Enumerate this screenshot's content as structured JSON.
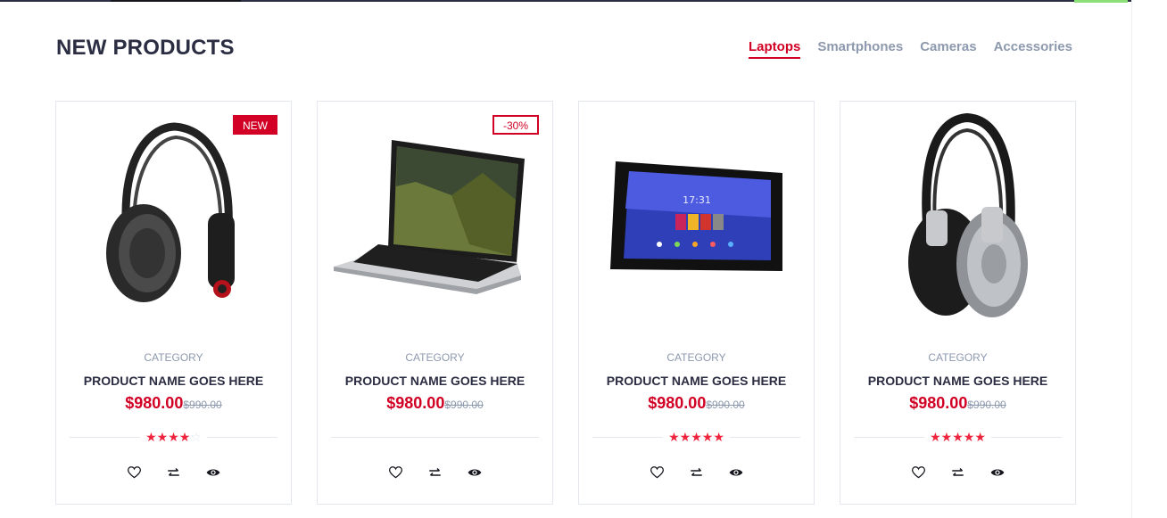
{
  "section": {
    "title": "NEW PRODUCTS"
  },
  "tabs": [
    {
      "label": "Laptops",
      "active": true
    },
    {
      "label": "Smartphones",
      "active": false
    },
    {
      "label": "Cameras",
      "active": false
    },
    {
      "label": "Accessories",
      "active": false
    }
  ],
  "products": [
    {
      "badge": "NEW",
      "badge_type": "new",
      "image": "headphones-black-icon",
      "category": "CATEGORY",
      "name": "PRODUCT NAME GOES HERE",
      "price": "$980.00",
      "old_price": "$990.00",
      "rating": 4
    },
    {
      "badge": "-30%",
      "badge_type": "sale",
      "image": "laptop-icon",
      "category": "CATEGORY",
      "name": "PRODUCT NAME GOES HERE",
      "price": "$980.00",
      "old_price": "$990.00",
      "rating": 0
    },
    {
      "badge": "",
      "badge_type": "",
      "image": "tablet-icon",
      "category": "CATEGORY",
      "name": "PRODUCT NAME GOES HERE",
      "price": "$980.00",
      "old_price": "$990.00",
      "rating": 5
    },
    {
      "badge": "",
      "badge_type": "",
      "image": "headphones-silver-icon",
      "category": "CATEGORY",
      "name": "PRODUCT NAME GOES HERE",
      "price": "$980.00",
      "old_price": "$990.00",
      "rating": 5
    }
  ],
  "colors": {
    "accent": "#d10024",
    "star": "#ef233c",
    "muted": "#8d99ae",
    "text": "#2b2d42"
  },
  "actions": [
    "wishlist-icon",
    "compare-icon",
    "quick-view-icon"
  ]
}
